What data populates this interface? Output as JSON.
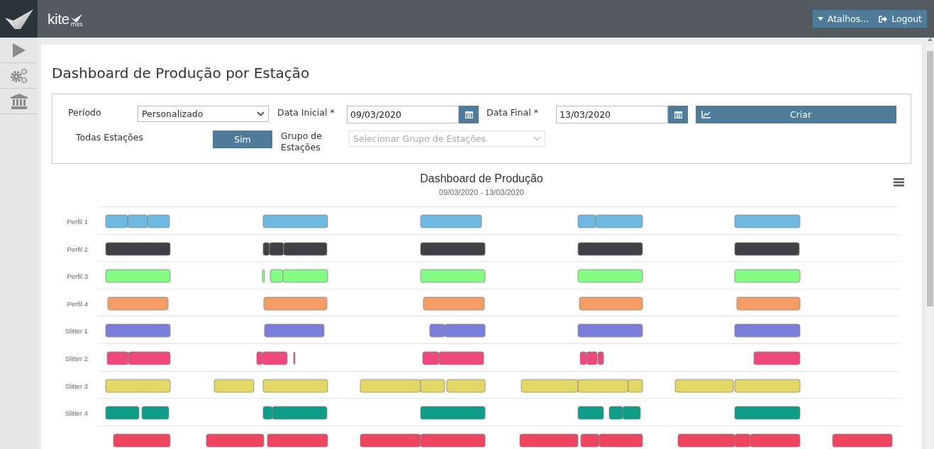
{
  "header": {
    "logo": "kite",
    "logo_sub": "mes",
    "buttons": [
      {
        "label": "Atalhos...",
        "kind": "dropdown"
      },
      {
        "label": "Logout",
        "kind": "logout"
      }
    ]
  },
  "sidebar": {
    "items": [
      {
        "kind": "play"
      },
      {
        "kind": "gears"
      },
      {
        "kind": "bank"
      }
    ]
  },
  "page_title": "Dashboard de Produção por Estação",
  "form": {
    "periodo": {
      "label": "Período",
      "value": "Personalizado"
    },
    "data_inicial": {
      "label": "Data Inicial",
      "required_mark": "*",
      "value": "09/03/2020"
    },
    "data_final": {
      "label": "Data Final",
      "required_mark": "*",
      "value": "13/03/2020"
    },
    "criar": {
      "label": "Criar"
    },
    "todas_estacoes": {
      "label": "Todas Estações",
      "value": "Sim"
    },
    "grupo": {
      "label": "Grupo de Estações",
      "placeholder": "Selecionar Grupo de Estações",
      "disabled": true
    }
  },
  "chart": {
    "title": "Dashboard de Produção",
    "subtitle": "09/03/2020 - 13/03/2020",
    "rows": [
      {
        "label": "Perfil 1",
        "color": "#6fb8e2"
      },
      {
        "label": "Perfil 2",
        "color": "#404144"
      },
      {
        "label": "Perfil 3",
        "color": "#86fb86"
      },
      {
        "label": "Perfil 4",
        "color": "#f49c64"
      },
      {
        "label": "Slitter 1",
        "color": "#7a80da"
      },
      {
        "label": "Slitter 2",
        "color": "#f0477c"
      },
      {
        "label": "Slitter 3",
        "color": "#e3d766"
      },
      {
        "label": "Slitter 4",
        "color": "#0f9c89"
      },
      {
        "color": "#ee4560"
      }
    ]
  }
}
